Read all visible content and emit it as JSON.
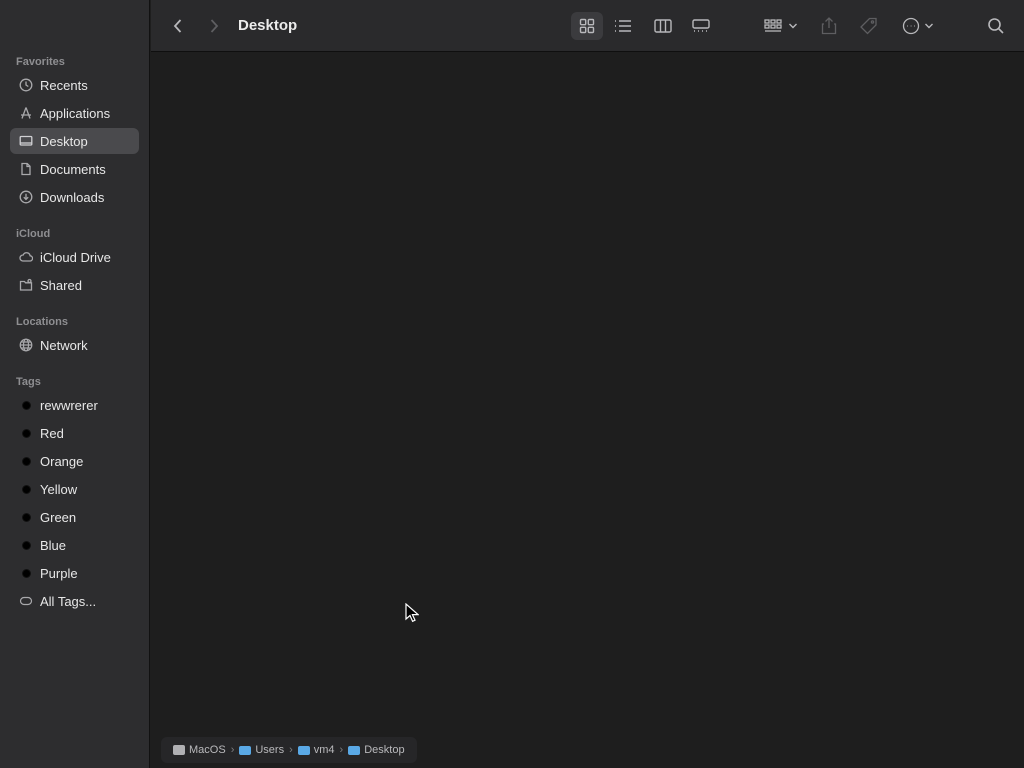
{
  "window": {
    "title": "Desktop"
  },
  "sidebar": {
    "sections": {
      "favorites": "Favorites",
      "icloud": "iCloud",
      "locations": "Locations",
      "tags": "Tags"
    },
    "favorites": [
      {
        "label": "Recents",
        "icon": "clock-icon"
      },
      {
        "label": "Applications",
        "icon": "applications-icon"
      },
      {
        "label": "Desktop",
        "icon": "desktop-icon",
        "selected": true
      },
      {
        "label": "Documents",
        "icon": "document-icon"
      },
      {
        "label": "Downloads",
        "icon": "download-icon"
      }
    ],
    "icloud": [
      {
        "label": "iCloud Drive",
        "icon": "cloud-icon"
      },
      {
        "label": "Shared",
        "icon": "shared-folder-icon"
      }
    ],
    "locations": [
      {
        "label": "Network",
        "icon": "globe-icon"
      }
    ],
    "tags": [
      {
        "label": "rewwrerer"
      },
      {
        "label": "Red"
      },
      {
        "label": "Orange"
      },
      {
        "label": "Yellow"
      },
      {
        "label": "Green"
      },
      {
        "label": "Blue"
      },
      {
        "label": "Purple"
      },
      {
        "label": "All Tags...",
        "icon": "all-tags-icon"
      }
    ]
  },
  "pathbar": {
    "items": [
      "MacOS",
      "Users",
      "vm4",
      "Desktop"
    ]
  }
}
